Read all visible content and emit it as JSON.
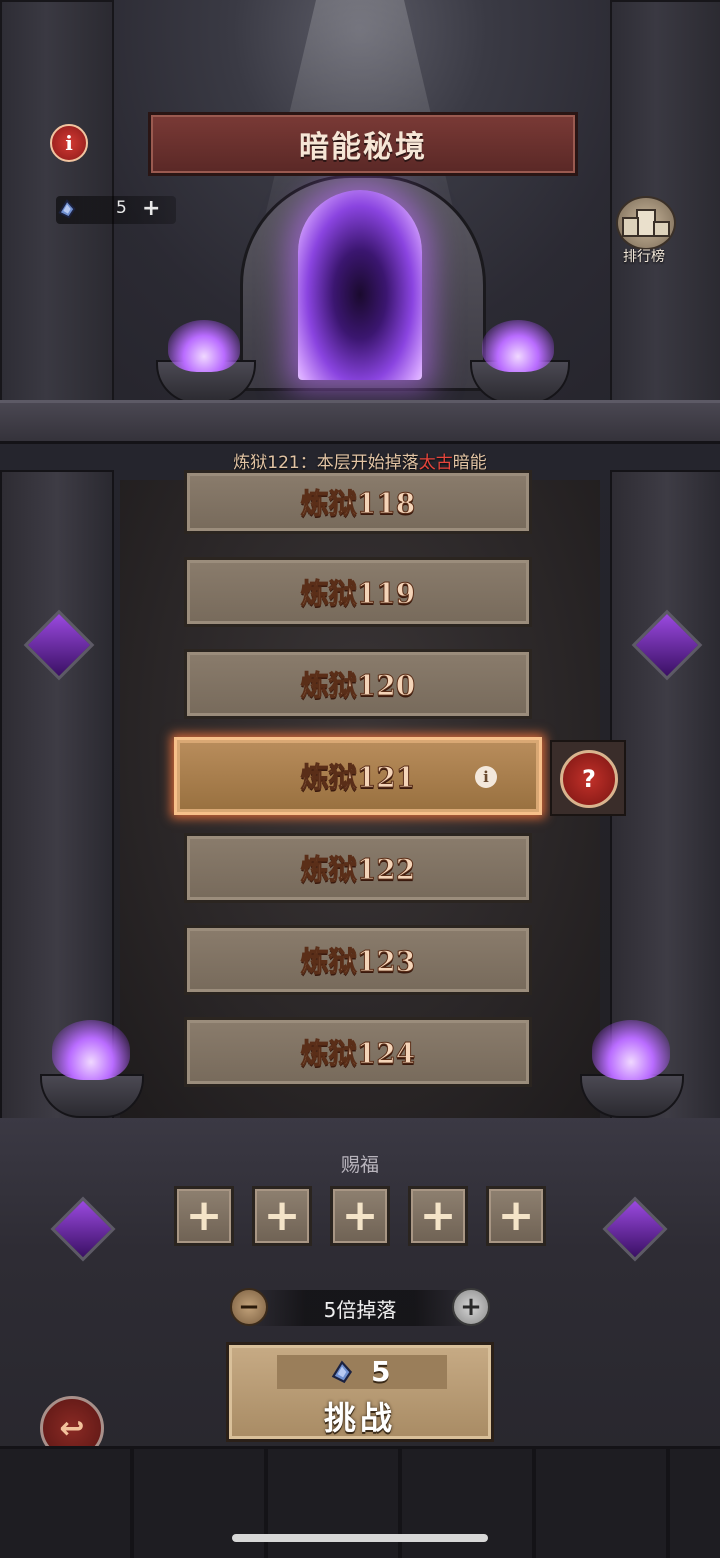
{
  "header": {
    "title": "暗能秘境",
    "info_icon": "i",
    "currency_value": "5",
    "currency_plus": "+",
    "ranking_label": "排行榜"
  },
  "notice": {
    "prefix": "炼狱121：本层开始掉落",
    "highlight": "太古",
    "suffix": "暗能"
  },
  "levels": [
    {
      "label": "炼狱118"
    },
    {
      "label": "炼狱119"
    },
    {
      "label": "炼狱120"
    },
    {
      "label": "炼狱121",
      "selected": true
    },
    {
      "label": "炼狱122"
    },
    {
      "label": "炼狱123"
    },
    {
      "label": "炼狱124"
    }
  ],
  "mystery_icon": "?",
  "blessing": {
    "label": "赐福",
    "slots": [
      "+",
      "+",
      "+",
      "+",
      "+"
    ]
  },
  "multiplier": {
    "minus": "−",
    "text": "5倍掉落",
    "plus": "+"
  },
  "challenge": {
    "cost": "5",
    "label": "挑战"
  },
  "back_icon": "↩",
  "colors": {
    "highlight_red": "#e6453c",
    "portal_purple": "#8a44e0",
    "selected_glow": "#ff783c"
  }
}
